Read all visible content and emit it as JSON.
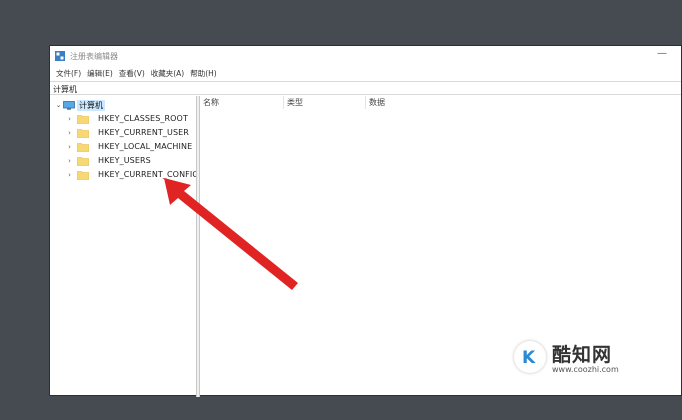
{
  "window": {
    "title": "注册表编辑器",
    "minimize_glyph": "—"
  },
  "menu": [
    {
      "label": "文件(F)"
    },
    {
      "label": "编辑(E)"
    },
    {
      "label": "查看(V)"
    },
    {
      "label": "收藏夹(A)"
    },
    {
      "label": "帮助(H)"
    }
  ],
  "address": "计算机",
  "tree": {
    "root": {
      "label": "计算机",
      "icon": "computer-icon",
      "expanded": true
    },
    "items": [
      {
        "label": "HKEY_CLASSES_ROOT",
        "icon": "folder-icon"
      },
      {
        "label": "HKEY_CURRENT_USER",
        "icon": "folder-icon"
      },
      {
        "label": "HKEY_LOCAL_MACHINE",
        "icon": "folder-icon"
      },
      {
        "label": "HKEY_USERS",
        "icon": "folder-icon"
      },
      {
        "label": "HKEY_CURRENT_CONFIG",
        "icon": "folder-icon"
      }
    ]
  },
  "columns": [
    {
      "label": "名称"
    },
    {
      "label": "类型"
    },
    {
      "label": "数据"
    }
  ],
  "annotation": {
    "icon": "red-arrow-icon",
    "color": "#e02424"
  },
  "watermark": {
    "name": "酷知网",
    "url": "www.coozhi.com",
    "logo_letter": "K",
    "color": "#2a8ad8"
  },
  "colors": {
    "desktop": "#464b51",
    "selection": "#cce8ff",
    "folder": "#f8d775"
  }
}
